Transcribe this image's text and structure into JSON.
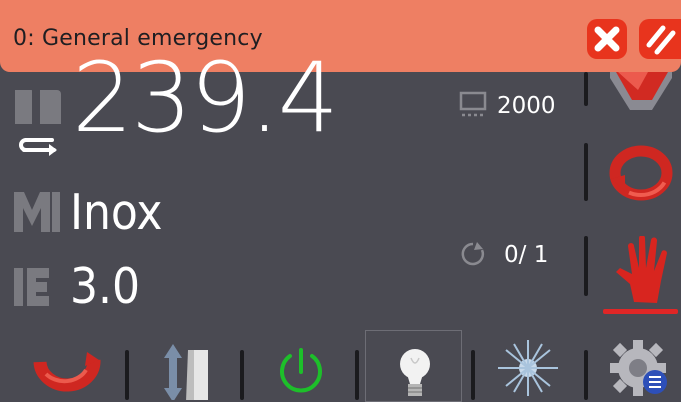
{
  "alarm": {
    "message": "0: General emergency",
    "close_icon": "close-x-icon",
    "reset_icon": "reset-slash-icon",
    "color": "#ee7f63"
  },
  "readouts": {
    "main_value": "239.4",
    "main_icon": "tool-length-icon",
    "material_icon": "material-m-icon",
    "material": "Inox",
    "thickness_icon": "thickness-e-icon",
    "thickness": "3.0",
    "stroke_icon": "panel-icon",
    "stroke_value": "2000",
    "cycle_icon": "cycle-counter-icon",
    "cycle_value": "0/ 1"
  },
  "right_toolbar": [
    "mode-icon",
    "repeat-cycle-icon",
    "manual-hand-icon"
  ],
  "bottom_toolbar": [
    "undo-arc-icon",
    "bend-direction-icon",
    "power-icon",
    "lamp-icon",
    "laser-icon",
    "settings-gear-icon"
  ],
  "colors": {
    "background": "#4a4a52",
    "accent_red": "#e02626",
    "power_green": "#1dbf2a",
    "alarm_button": "#e8341d"
  }
}
